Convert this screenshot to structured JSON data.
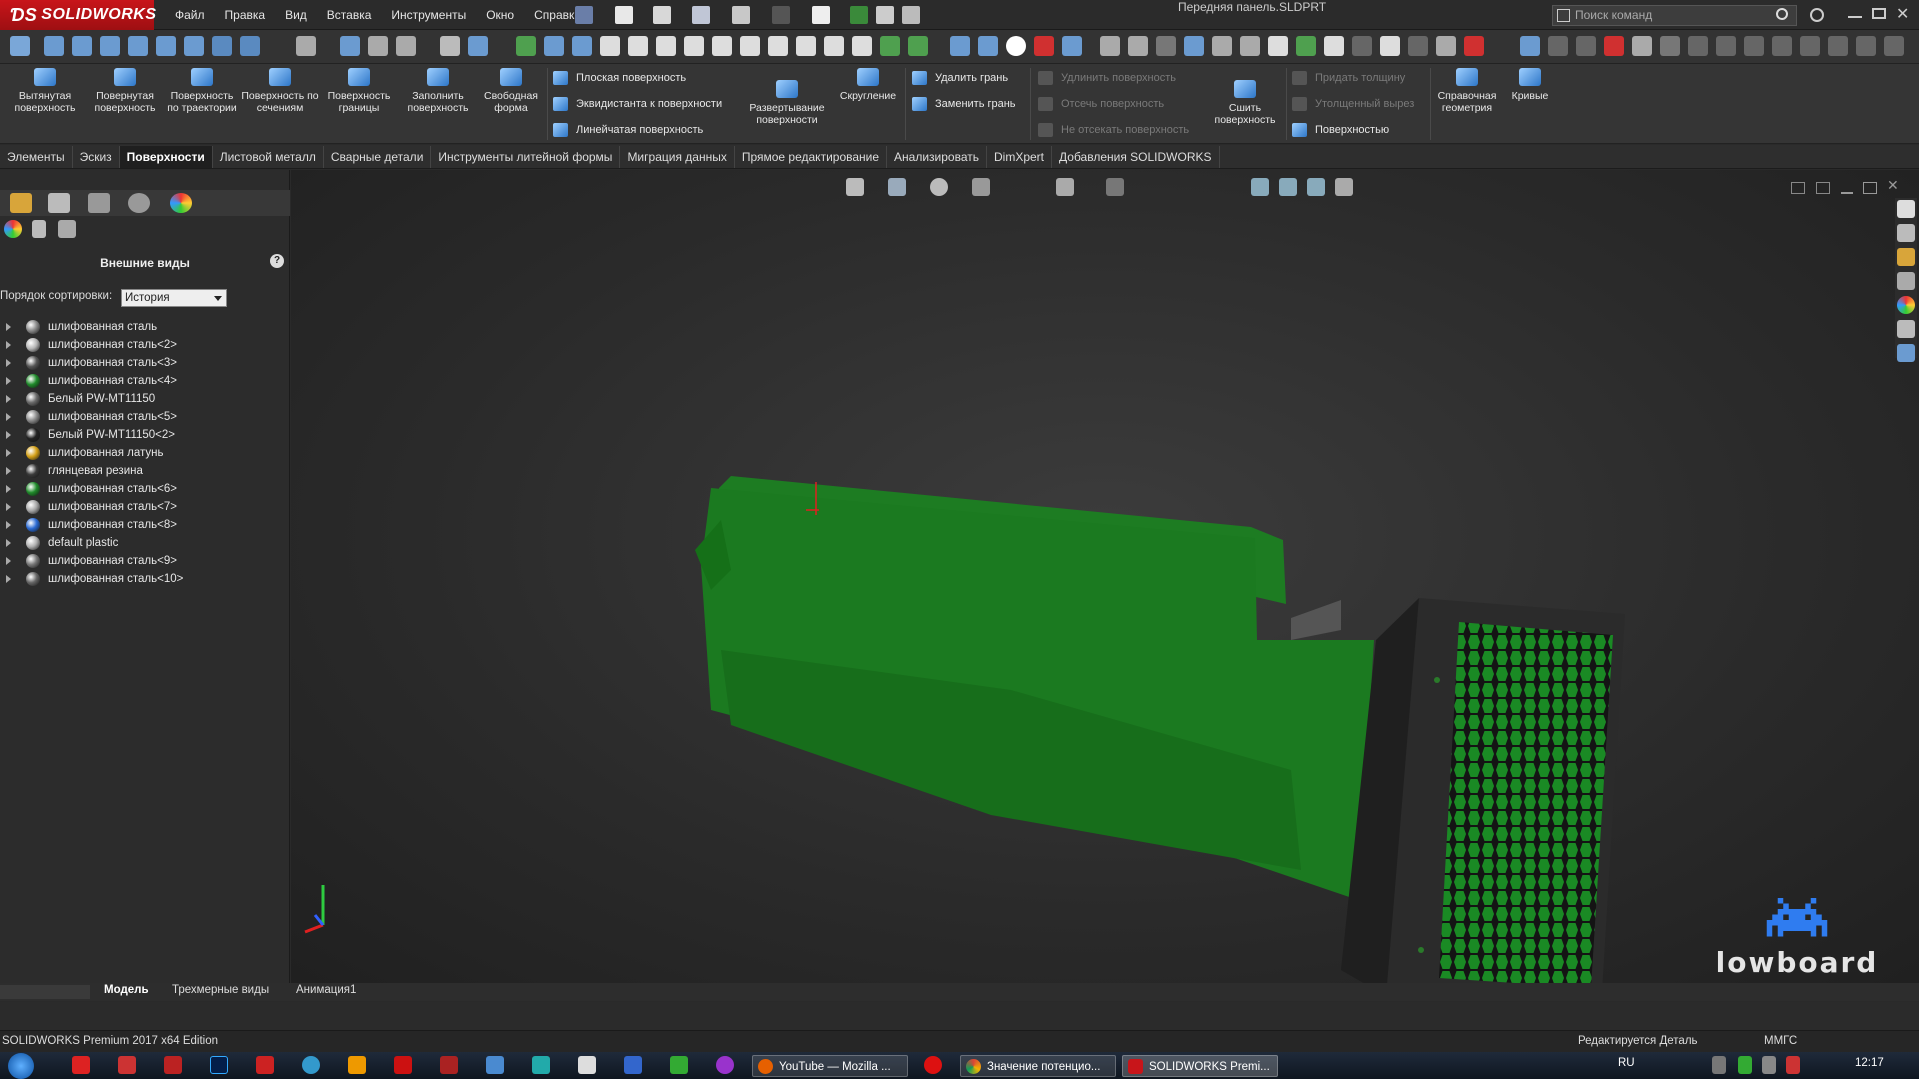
{
  "app": {
    "name": "SOLIDWORKS",
    "document_title": "Передняя панель.SLDPRT"
  },
  "menu": [
    "Файл",
    "Правка",
    "Вид",
    "Вставка",
    "Инструменты",
    "Окно",
    "Справка"
  ],
  "search": {
    "placeholder": "Поиск команд"
  },
  "ribbon": {
    "big_buttons": [
      "Вытянутая поверхность",
      "Повернутая поверхность",
      "Поверхность по траектории",
      "Поверхность по сечениям",
      "Поверхность границы",
      "Заполнить поверхность",
      "Свободная форма"
    ],
    "group1": [
      "Плоская поверхность",
      "Эквидистанта к поверхности",
      "Линейчатая поверхность"
    ],
    "unfold": "Развертывание поверхности",
    "fillet": "Скругление",
    "group2": [
      "Удалить грань",
      "Заменить грань"
    ],
    "group3": [
      "Удлинить поверхность",
      "Отсечь поверхность",
      "Не отсекать поверхность"
    ],
    "knit": "Сшить поверхность",
    "group4": [
      "Придать толщину",
      "Утолщенный вырез",
      "Поверхностью"
    ],
    "ref_geometry": "Справочная геометрия",
    "curves": "Кривые"
  },
  "tabs": [
    {
      "label": "Элементы",
      "active": false
    },
    {
      "label": "Эскиз",
      "active": false
    },
    {
      "label": "Поверхности",
      "active": true
    },
    {
      "label": "Листовой металл",
      "active": false
    },
    {
      "label": "Сварные детали",
      "active": false
    },
    {
      "label": "Инструменты литейной формы",
      "active": false
    },
    {
      "label": "Миграция данных",
      "active": false
    },
    {
      "label": "Прямое редактирование",
      "active": false
    },
    {
      "label": "Анализировать",
      "active": false
    },
    {
      "label": "DimXpert",
      "active": false
    },
    {
      "label": "Добавления SOLIDWORKS",
      "active": false
    }
  ],
  "panel": {
    "title": "Внешние виды",
    "help": "?",
    "sort_label": "Порядок сортировки:",
    "sort_value": "История",
    "appearances": [
      {
        "label": "шлифованная сталь",
        "color": "#8a8a8a"
      },
      {
        "label": "шлифованная сталь<2>",
        "color": "#b5b5b5"
      },
      {
        "label": "шлифованная сталь<3>",
        "color": "#555555"
      },
      {
        "label": "шлифованная сталь<4>",
        "color": "#1f8a2a"
      },
      {
        "label": "Белый PW-MT11150",
        "color": "#6a6a6a"
      },
      {
        "label": "шлифованная сталь<5>",
        "color": "#8a8a8a"
      },
      {
        "label": "Белый PW-MT11150<2>",
        "color": "#222222"
      },
      {
        "label": "шлифованная латунь",
        "color": "#d4a017"
      },
      {
        "label": "глянцевая резина",
        "color": "#3a3a3a"
      },
      {
        "label": "шлифованная сталь<6>",
        "color": "#1f8a2a"
      },
      {
        "label": "шлифованная сталь<7>",
        "color": "#a8a8a8"
      },
      {
        "label": "шлифованная сталь<8>",
        "color": "#2a6ad4"
      },
      {
        "label": "default plastic",
        "color": "#b0b0b0"
      },
      {
        "label": "шлифованная сталь<9>",
        "color": "#777777"
      },
      {
        "label": "шлифованная сталь<10>",
        "color": "#666666"
      }
    ]
  },
  "bottom_tabs": [
    "Модель",
    "Трехмерные виды",
    "Анимация1"
  ],
  "status": {
    "left": "SOLIDWORKS Premium 2017 x64 Edition",
    "editing": "Редактируется Деталь",
    "units": "ММГС"
  },
  "taskbar": {
    "apps": [
      "YouTube — Mozilla ...",
      "Значение потенцио...",
      "SOLIDWORKS Premi..."
    ],
    "lang": "RU",
    "time": "12:17"
  },
  "watermark": "lowboard",
  "colors": {
    "accent_red": "#c8151a",
    "part_green": "#1e7a22",
    "ribbon_bg": "#353535"
  }
}
